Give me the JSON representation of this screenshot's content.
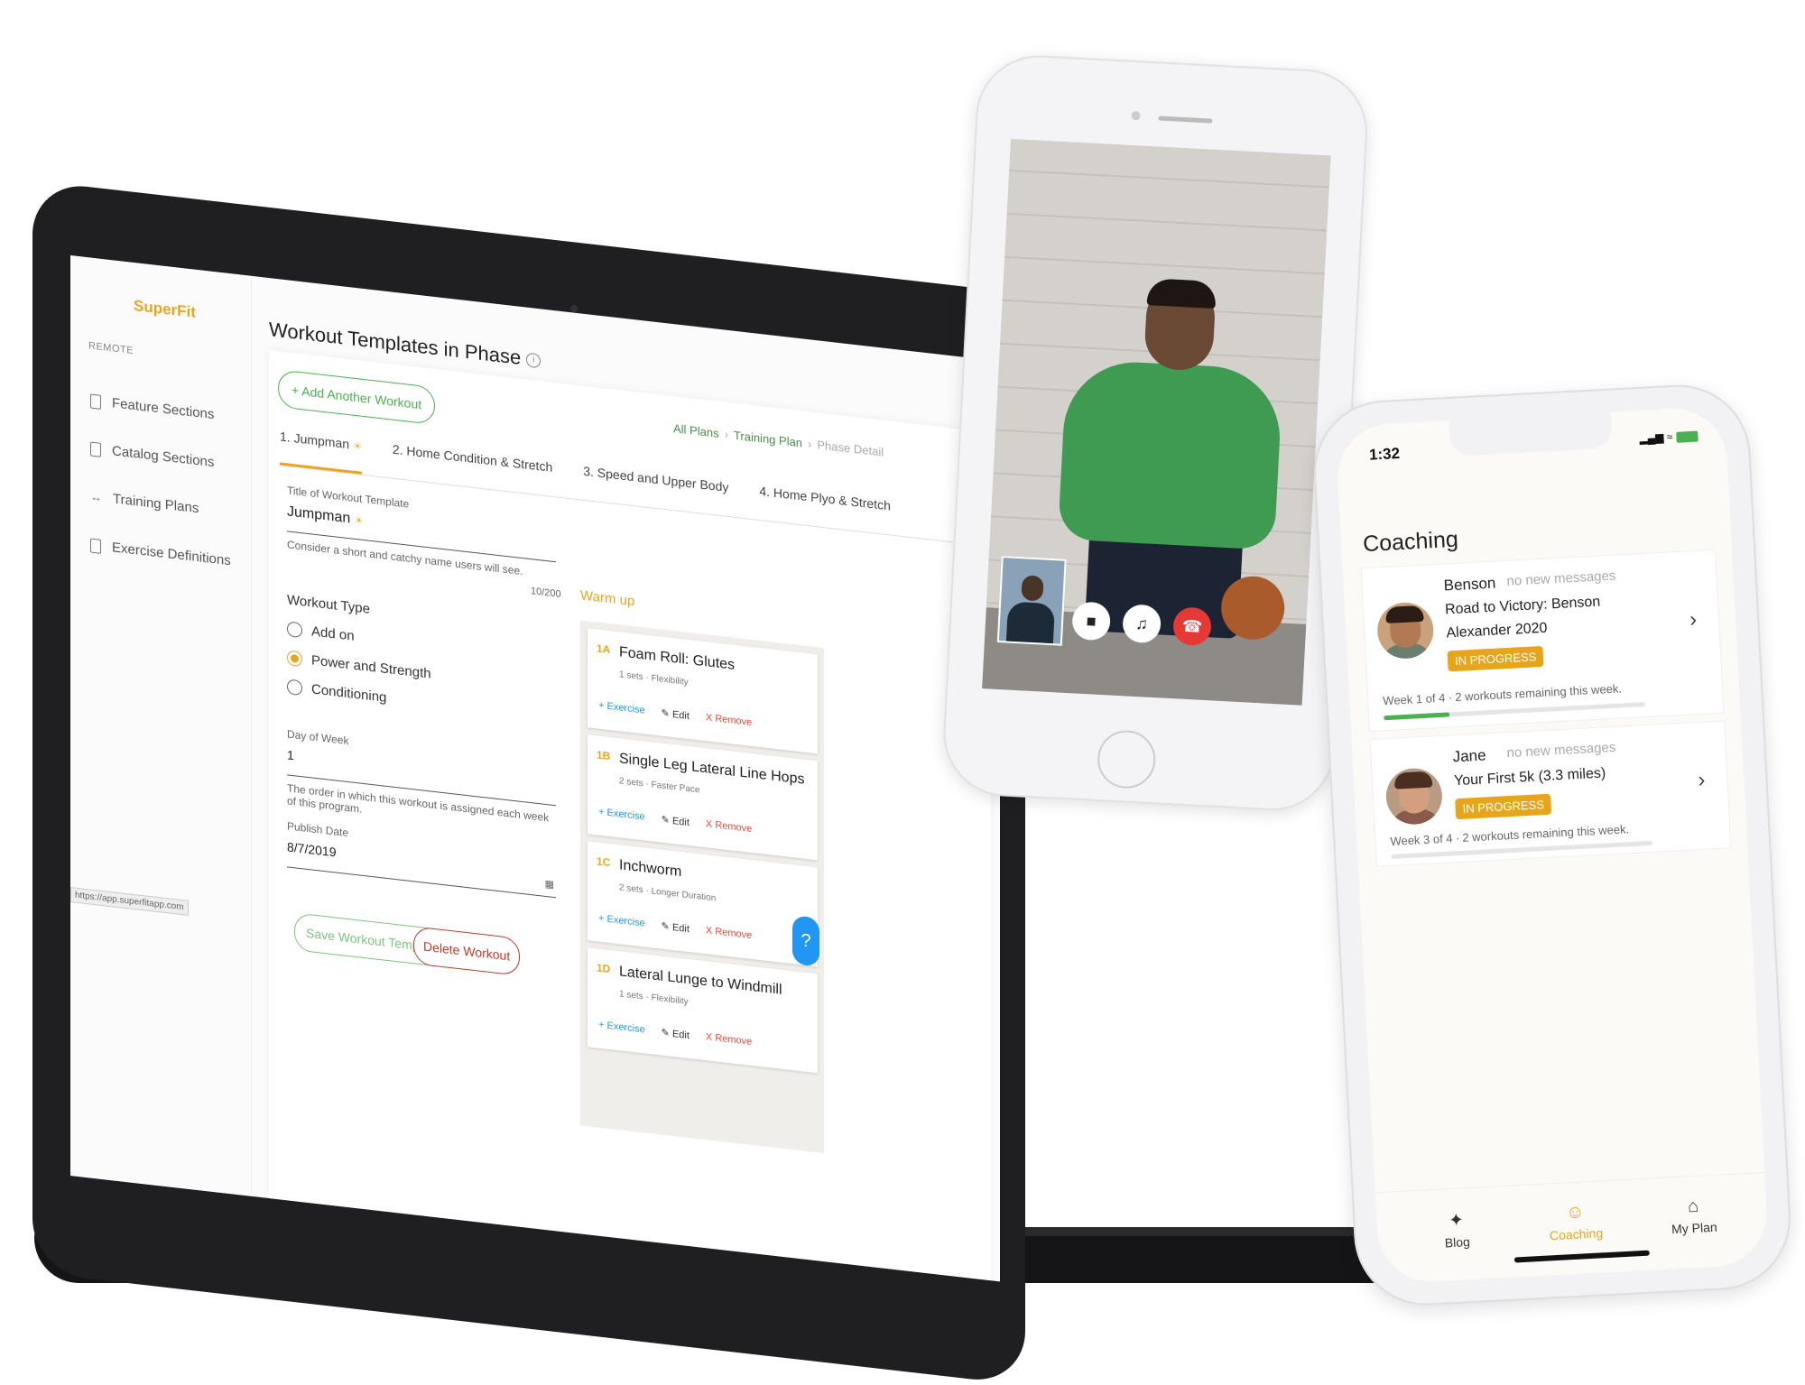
{
  "colors": {
    "accent": "#e9a520",
    "green": "#4caf50",
    "danger": "#e74c3c",
    "link": "#2196f3"
  },
  "admin": {
    "logo": "SuperFit",
    "section_label": "REMOTE",
    "sidebar": [
      {
        "label": "Feature Sections",
        "icon": "bookmark-icon"
      },
      {
        "label": "Catalog Sections",
        "icon": "bookmark-icon"
      },
      {
        "label": "Training Plans",
        "icon": "arrows-icon"
      },
      {
        "label": "Exercise Definitions",
        "icon": "book-icon"
      }
    ],
    "page_title": "Workout Templates in Phase",
    "add_button": "+ Add Another Workout",
    "breadcrumbs": [
      "All Plans",
      "Training Plan",
      "Phase Detail"
    ],
    "tabs": [
      "1. Jumpman",
      "2. Home Condition & Stretch",
      "3. Speed and Upper Body",
      "4. Home Plyo & Stretch"
    ],
    "form": {
      "title_label": "Title of Workout Template",
      "title_value": "Jumpman",
      "title_hint": "Consider a short and catchy name users will see.",
      "title_count": "10/200",
      "type_label": "Workout Type",
      "types": [
        "Add on",
        "Power and Strength",
        "Conditioning"
      ],
      "day_label": "Day of Week",
      "day_value": "1",
      "day_hint": "The order in which this workout is assigned each week of this program.",
      "publish_label": "Publish Date",
      "publish_value": "8/7/2019",
      "save_label": "Save Workout Template",
      "delete_label": "Delete Workout"
    },
    "warmup_label": "Warm up",
    "exercises": [
      {
        "tag": "1A",
        "name": "Foam Roll: Glutes",
        "sub": "1 sets · Flexibility"
      },
      {
        "tag": "1B",
        "name": "Single Leg Lateral Line Hops",
        "sub": "2 sets · Faster Pace"
      },
      {
        "tag": "1C",
        "name": "Inchworm",
        "sub": "2 sets · Longer Duration"
      },
      {
        "tag": "1D",
        "name": "Lateral Lunge to Windmill",
        "sub": "1 sets · Flexibility"
      }
    ],
    "actions": {
      "exercise": "+ Exercise",
      "edit": "Edit",
      "remove": "X Remove"
    },
    "help": "?",
    "url": "https://app.superfitapp.com"
  },
  "video_call": {
    "controls": [
      "video-camera-icon",
      "speaker-icon",
      "hang-up-icon"
    ]
  },
  "mobile": {
    "time": "1:32",
    "title": "Coaching",
    "cards": [
      {
        "name": "Benson",
        "messages": "no new messages",
        "program": "Road to Victory: Benson Alexander 2020",
        "status": "IN PROGRESS",
        "week": "Week 1 of 4 ·",
        "remaining": "2 workouts remaining this week.",
        "progress": 0.25
      },
      {
        "name": "Jane",
        "messages": "no new messages",
        "program": "Your First 5k (3.3 miles)",
        "status": "IN PROGRESS",
        "week": "Week 3 of 4 ·",
        "remaining": "2 workouts remaining this week.",
        "progress": 0
      }
    ],
    "tabs": [
      {
        "label": "Blog",
        "icon": "sparkle-icon"
      },
      {
        "label": "Coaching",
        "icon": "chat-icon"
      },
      {
        "label": "My Plan",
        "icon": "home-icon"
      }
    ]
  }
}
